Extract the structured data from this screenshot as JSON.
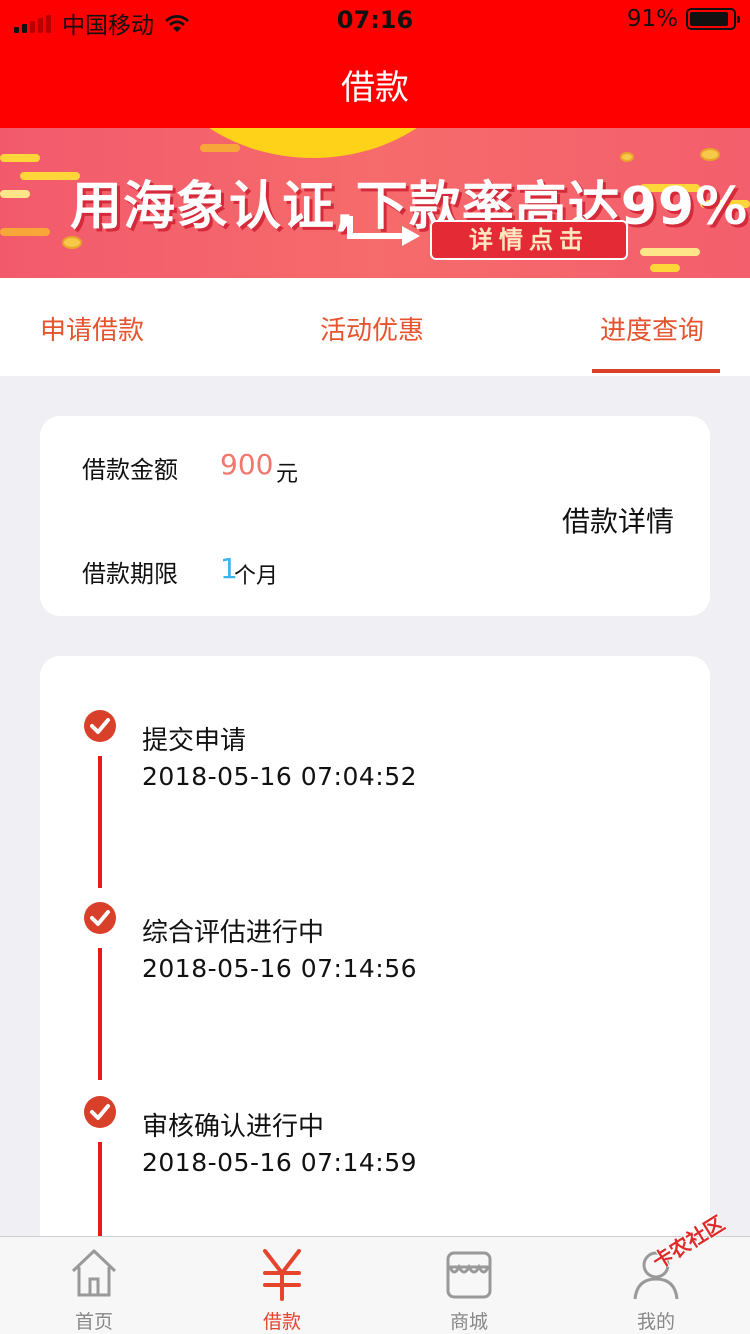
{
  "status_bar": {
    "carrier": "中国移动",
    "time": "07:16",
    "battery_percent": "91%",
    "battery_level": 0.91,
    "signal_bars": 2
  },
  "nav": {
    "title": "借款"
  },
  "banner": {
    "headline": "用海象认证,下款率高达99%!",
    "button_label": "详情点击"
  },
  "tabs": [
    {
      "label": "申请借款",
      "active": false
    },
    {
      "label": "活动优惠",
      "active": false
    },
    {
      "label": "进度查询",
      "active": true
    }
  ],
  "loan_summary": {
    "amount_label": "借款金额",
    "amount_value": "900",
    "amount_unit": "元",
    "term_label": "借款期限",
    "term_value": "1",
    "term_unit": "个月",
    "detail_link": "借款详情"
  },
  "timeline": [
    {
      "title": "提交申请",
      "time": "2018-05-16 07:04:52"
    },
    {
      "title": "综合评估进行中",
      "time": "2018-05-16 07:14:56"
    },
    {
      "title": "审核确认进行中",
      "time": "2018-05-16 07:14:59"
    }
  ],
  "tab_bar": [
    {
      "label": "首页",
      "icon": "home-icon",
      "active": false
    },
    {
      "label": "借款",
      "icon": "yen-icon",
      "active": true
    },
    {
      "label": "商城",
      "icon": "shop-icon",
      "active": false
    },
    {
      "label": "我的",
      "icon": "user-icon",
      "active": false
    }
  ],
  "watermark": "卡农社区",
  "colors": {
    "header_red": "#ff0000",
    "accent_orange": "#e6542f",
    "amount_color": "#f2786e",
    "term_color": "#3cb4ee",
    "timeline_red": "#e61c1c"
  }
}
